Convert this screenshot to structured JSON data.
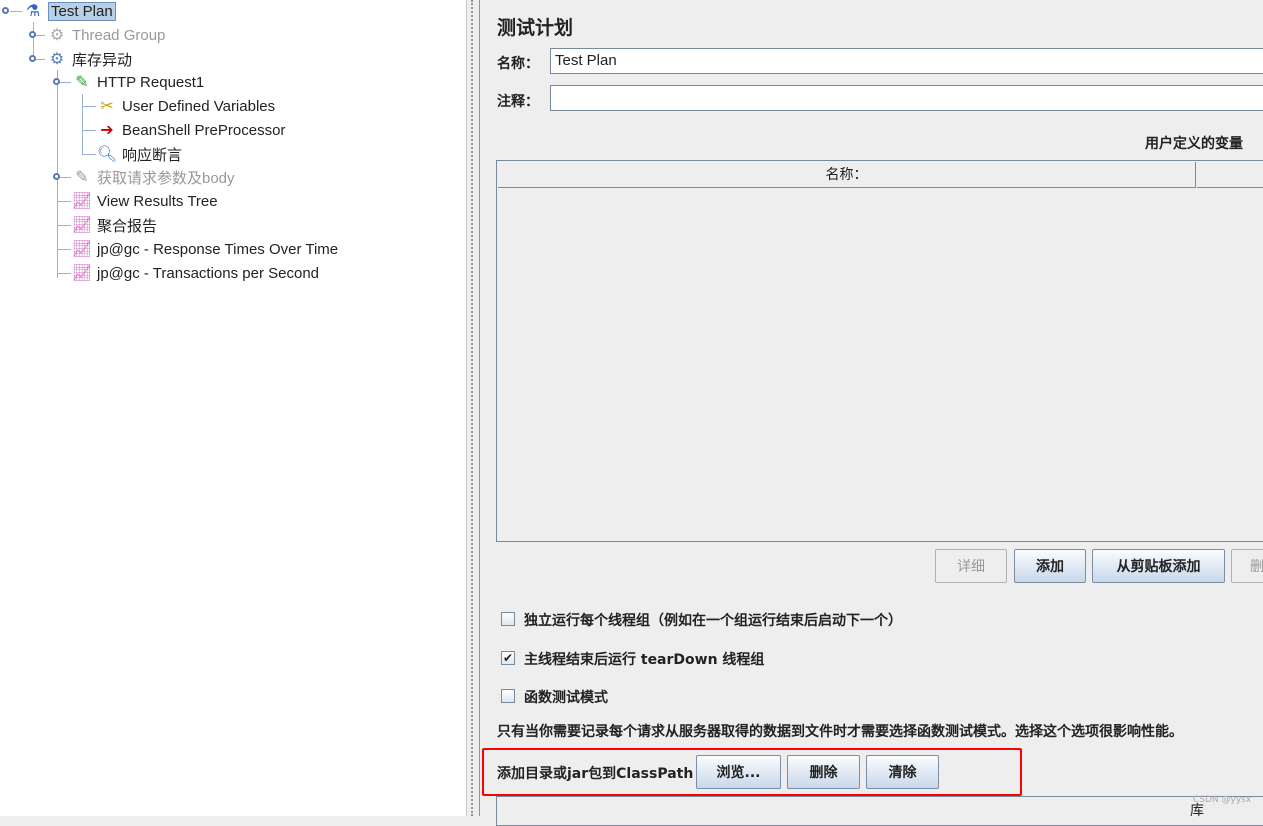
{
  "tree": [
    {
      "label": "Test Plan",
      "icon": "flask-icon",
      "selected": true
    },
    {
      "label": "Thread Group",
      "icon": "gear-icon",
      "disabled": true
    },
    {
      "label": "库存异动",
      "icon": "gear-icon"
    },
    {
      "label": "HTTP Request1",
      "icon": "pipette-icon"
    },
    {
      "label": "User Defined Variables",
      "icon": "tools-icon"
    },
    {
      "label": "BeanShell PreProcessor",
      "icon": "arrow-page-icon"
    },
    {
      "label": "响应断言",
      "icon": "magnifier-icon"
    },
    {
      "label": "获取请求参数及body",
      "icon": "pipette-icon",
      "disabled": true
    },
    {
      "label": "View Results Tree",
      "icon": "graph-icon"
    },
    {
      "label": "聚合报告",
      "icon": "graph-icon"
    },
    {
      "label": "jp@gc - Response Times Over Time",
      "icon": "graph-icon"
    },
    {
      "label": "jp@gc - Transactions per Second",
      "icon": "graph-icon"
    }
  ],
  "panel": {
    "title": "测试计划",
    "name_label": "名称：",
    "name_value": "Test Plan",
    "comment_label": "注释：",
    "comment_value": "",
    "vars_title": "用户定义的变量",
    "table_col": "名称：",
    "buttons": {
      "detail": "详细",
      "add": "添加",
      "add_clip": "从剪贴板添加",
      "delete": "删"
    },
    "cb1": {
      "label": "独立运行每个线程组（例如在一个组运行结束后启动下一个）",
      "checked": false
    },
    "cb2": {
      "label": "主线程结束后运行 tearDown 线程组",
      "checked": true
    },
    "cb3": {
      "label": "函数测试模式",
      "checked": false
    },
    "note": "只有当你需要记录每个请求从服务器取得的数据到文件时才需要选择函数测试模式。选择这个选项很影响性能。",
    "classpath_label": "添加目录或jar包到ClassPath",
    "browse": "浏览...",
    "remove": "删除",
    "clear": "清除",
    "list_item": "库"
  },
  "watermark": "CSDN @yysx",
  "highlight_color": "#ff0000"
}
